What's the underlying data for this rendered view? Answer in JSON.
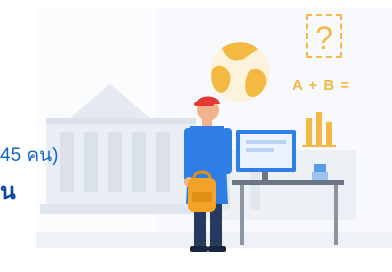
{
  "banner": {
    "count_text": "45 คน)",
    "heading_text": "น"
  },
  "illustration": {
    "question_mark": "?",
    "formula": "A + B ="
  },
  "colors": {
    "accent_blue": "#1565c0",
    "heading_blue": "#0d47a1",
    "accent_yellow": "#f4b942",
    "shirt_blue": "#2f7ee6",
    "building_gray": "#dfe6ee"
  },
  "icons": [
    "globe-icon",
    "question-icon",
    "bar-chart-icon",
    "monitor-icon",
    "backpack-icon",
    "student-icon",
    "building-icon"
  ]
}
